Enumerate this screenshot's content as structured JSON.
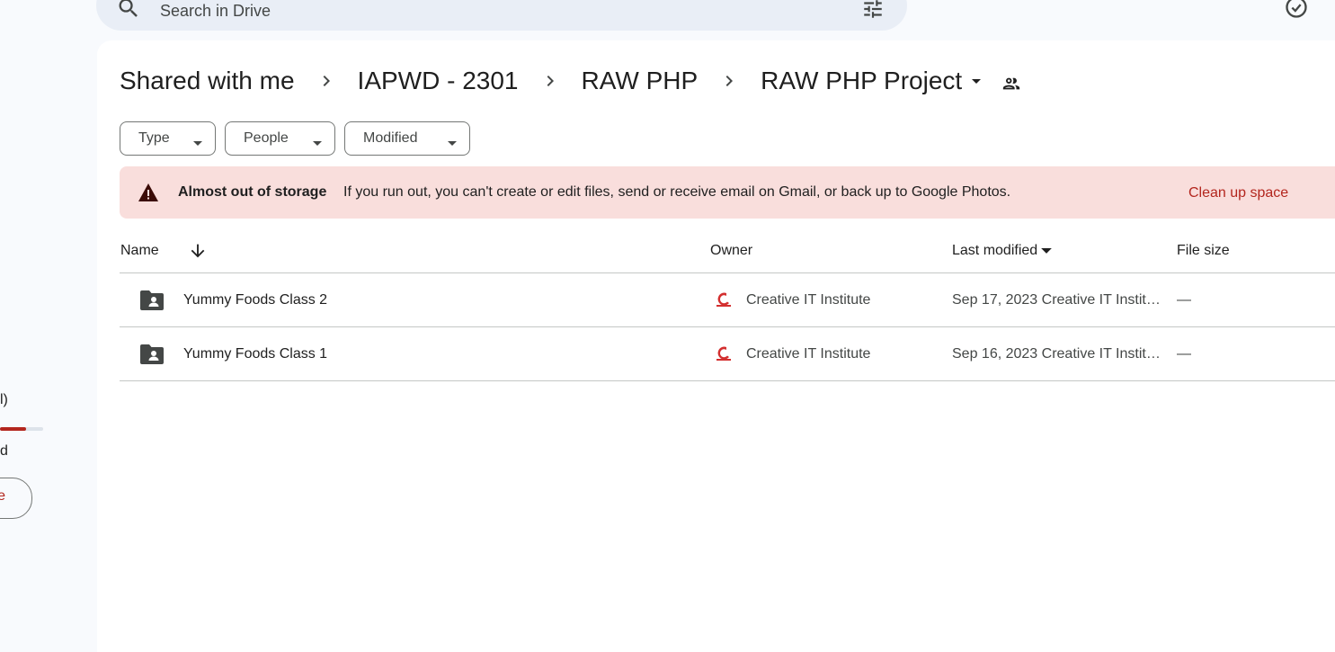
{
  "search": {
    "placeholder": "Search in Drive"
  },
  "sidebar": {
    "fragment_1": "l)",
    "fragment_2": "d",
    "storage_used_fraction": 0.6,
    "get_storage_fragment": "e"
  },
  "breadcrumb": {
    "items": [
      "Shared with me",
      "IAPWD - 2301",
      "RAW PHP",
      "RAW PHP Project"
    ]
  },
  "filters": {
    "type": "Type",
    "people": "People",
    "modified": "Modified"
  },
  "banner": {
    "title": "Almost out of storage",
    "text": "If you run out, you can't create or edit files, send or receive email on Gmail, or back up to Google Photos.",
    "action": "Clean up space"
  },
  "table": {
    "headers": {
      "name": "Name",
      "owner": "Owner",
      "last_modified": "Last modified",
      "file_size": "File size"
    },
    "rows": [
      {
        "name": "Yummy Foods Class 2",
        "owner": "Creative IT Institute",
        "modified": "Sep 17, 2023 Creative IT Institute",
        "size": "—"
      },
      {
        "name": "Yummy Foods Class 1",
        "owner": "Creative IT Institute",
        "modified": "Sep 16, 2023 Creative IT Institute",
        "size": "—"
      }
    ]
  },
  "colors": {
    "accent_red": "#b3261e",
    "banner_bg": "#f9dedc",
    "panel_bg": "#ffffff",
    "app_bg": "#f8fafd"
  },
  "icons": [
    "search-icon",
    "tune-icon",
    "ready-for-offline-icon",
    "chevron-right-icon",
    "arrow-drop-down-icon",
    "shared-people-icon",
    "warning-icon",
    "arrow-down-icon",
    "shared-folder-icon",
    "owner-avatar-icon"
  ]
}
